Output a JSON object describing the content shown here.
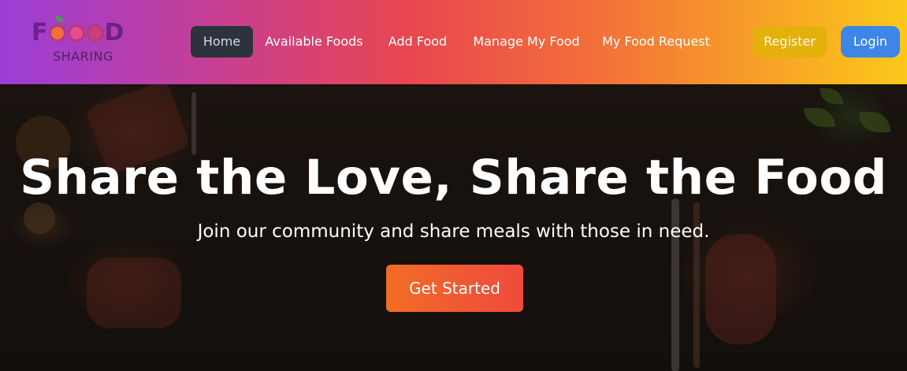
{
  "brand": {
    "logo_text": "FOOOD",
    "logo_subtitle": "SHARING"
  },
  "nav": {
    "items": [
      {
        "label": "Home",
        "active": true
      },
      {
        "label": "Available Foods",
        "active": false
      },
      {
        "label": "Add Food",
        "active": false
      },
      {
        "label": "Manage My Food",
        "active": false
      },
      {
        "label": "My Food Request",
        "active": false
      }
    ],
    "register_label": "Register",
    "login_label": "Login"
  },
  "hero": {
    "title": "Share the Love, Share the Food",
    "subtitle": "Join our community and share meals with those in need.",
    "cta_label": "Get Started"
  },
  "colors": {
    "nav_gradient_start": "#9b3ed8",
    "nav_gradient_end": "#fbc81a",
    "register_bg": "#e3b00c",
    "login_bg": "#3d86e8",
    "cta_bg": "#f26c25"
  }
}
